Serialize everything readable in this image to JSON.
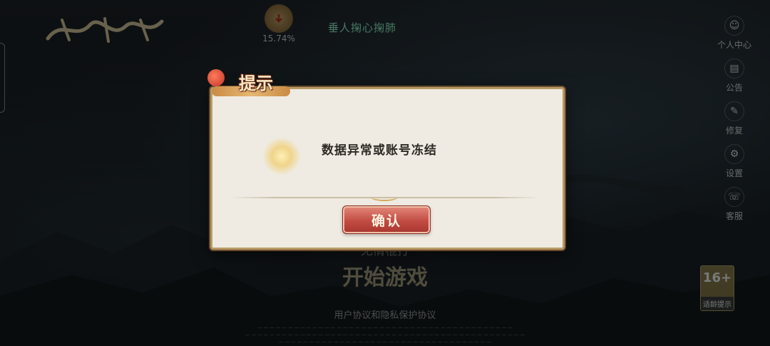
{
  "header": {
    "network_percent": "15.74%",
    "top_phrase": "垂人掬心掬肺"
  },
  "side_menu": [
    {
      "label": "个人中心",
      "icon": "person-icon"
    },
    {
      "label": "公告",
      "icon": "notice-icon"
    },
    {
      "label": "修复",
      "icon": "repair-icon"
    },
    {
      "label": "设置",
      "icon": "gear-icon"
    },
    {
      "label": "客服",
      "icon": "service-icon"
    }
  ],
  "background": {
    "sub_title": "无情棍打",
    "start_button": "开始游戏",
    "agreement": "用户协议和隐私保护协议",
    "rating": {
      "age": "16+",
      "caption": "适龄提示"
    }
  },
  "dialog": {
    "title": "提示",
    "message": "数据异常或账号冻结",
    "confirm_label": "确认"
  }
}
